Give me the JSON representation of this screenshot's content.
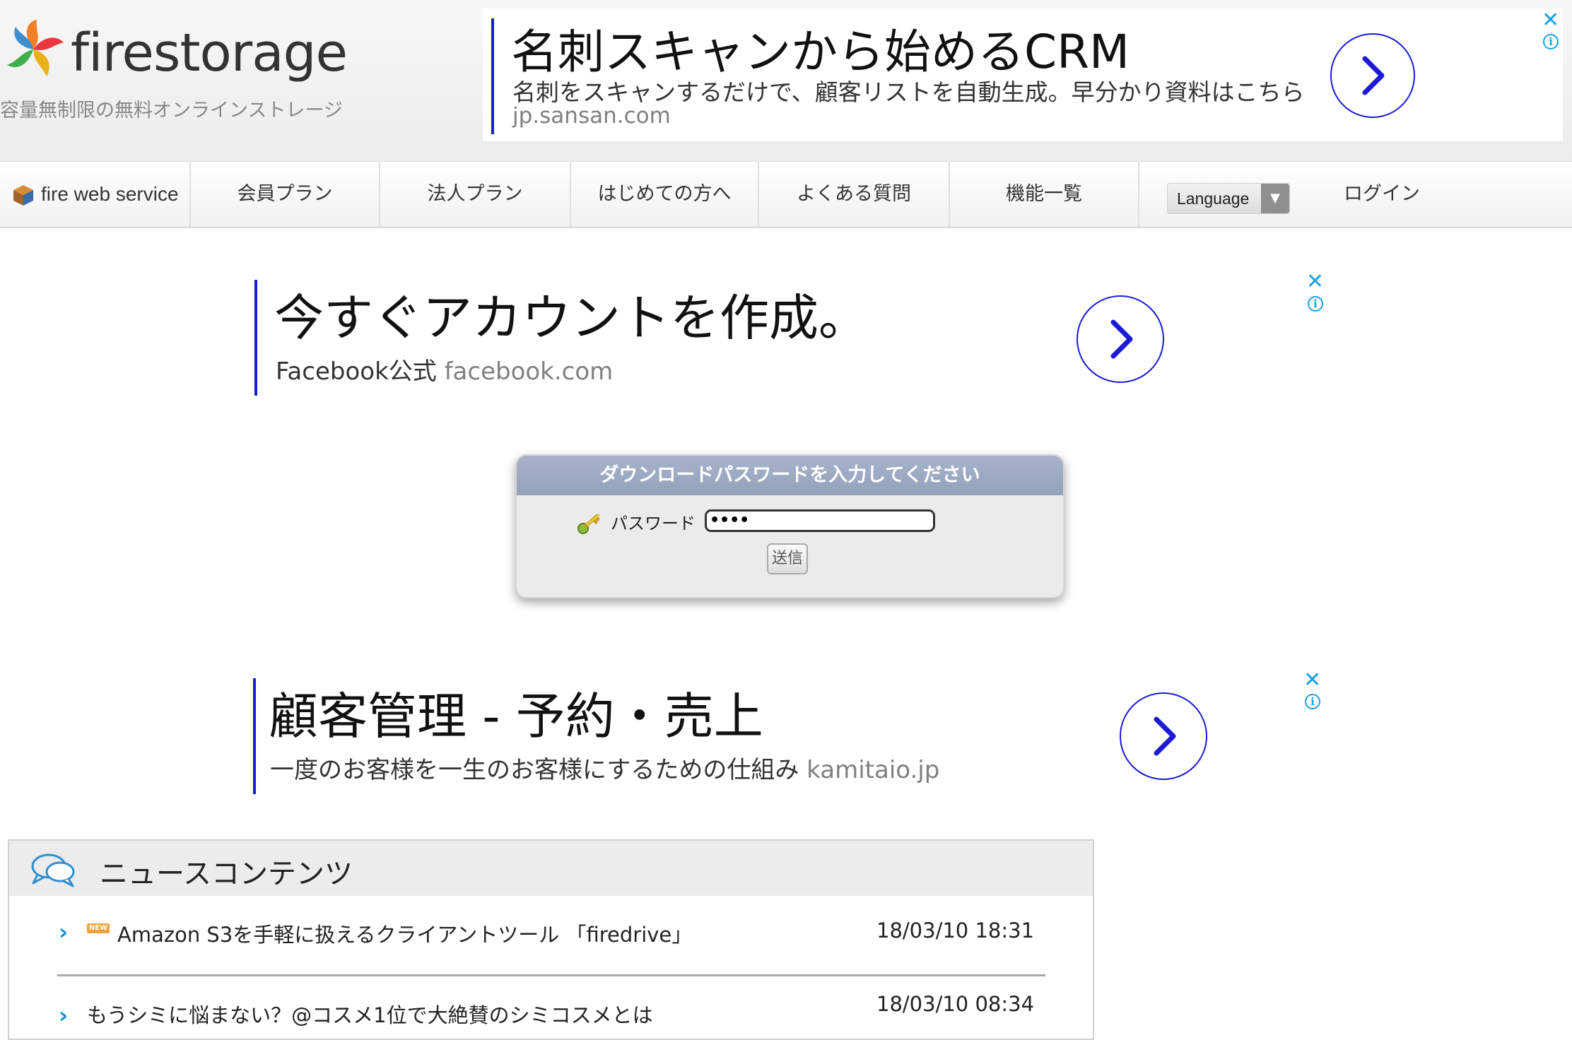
{
  "header": {
    "logo_text": "firestorage",
    "tagline": "容量無制限の無料オンラインストレージ"
  },
  "top_ad": {
    "title": "名刺スキャンから始めるCRM",
    "description": "名刺をスキャンするだけで、顧客リストを自動生成。早分かり資料はこちら",
    "url": "jp.sansan.com",
    "close_symbol": "✕"
  },
  "nav": {
    "items": [
      {
        "label": "fire web service"
      },
      {
        "label": "会員プラン"
      },
      {
        "label": "法人プラン"
      },
      {
        "label": "はじめての方へ"
      },
      {
        "label": "よくある質問"
      },
      {
        "label": "機能一覧"
      }
    ],
    "language_label": "Language",
    "language_caret": "▼",
    "login_label": "ログイン"
  },
  "ad_facebook": {
    "title": "今すぐアカウントを作成。",
    "advertiser": "Facebook公式",
    "url": "facebook.com",
    "close_symbol": "✕"
  },
  "password_form": {
    "heading": "ダウンロードパスワードを入力してください",
    "label": "パスワード",
    "value": "••••",
    "submit_label": "送信"
  },
  "ad_kamitaio": {
    "title": "顧客管理 - 予約・売上",
    "description": "一度のお客様を一生のお客様にするための仕組み",
    "url": "kamitaio.jp",
    "close_symbol": "✕"
  },
  "news": {
    "title": "ニュースコンテンツ",
    "new_badge": "NEW",
    "items": [
      {
        "text": "Amazon S3を手軽に扱えるクライアントツール 「firedrive」",
        "date": "18/03/10 18:31"
      },
      {
        "text": "もうシミに悩まない？@コスメ1位で大絶賛のシミコスメとは",
        "date": "18/03/10 08:34"
      }
    ]
  },
  "colors": {
    "ad_accent": "#1b1bd6",
    "adchoices": "#1aa1e6",
    "panel_header": "#9aa6bf"
  }
}
